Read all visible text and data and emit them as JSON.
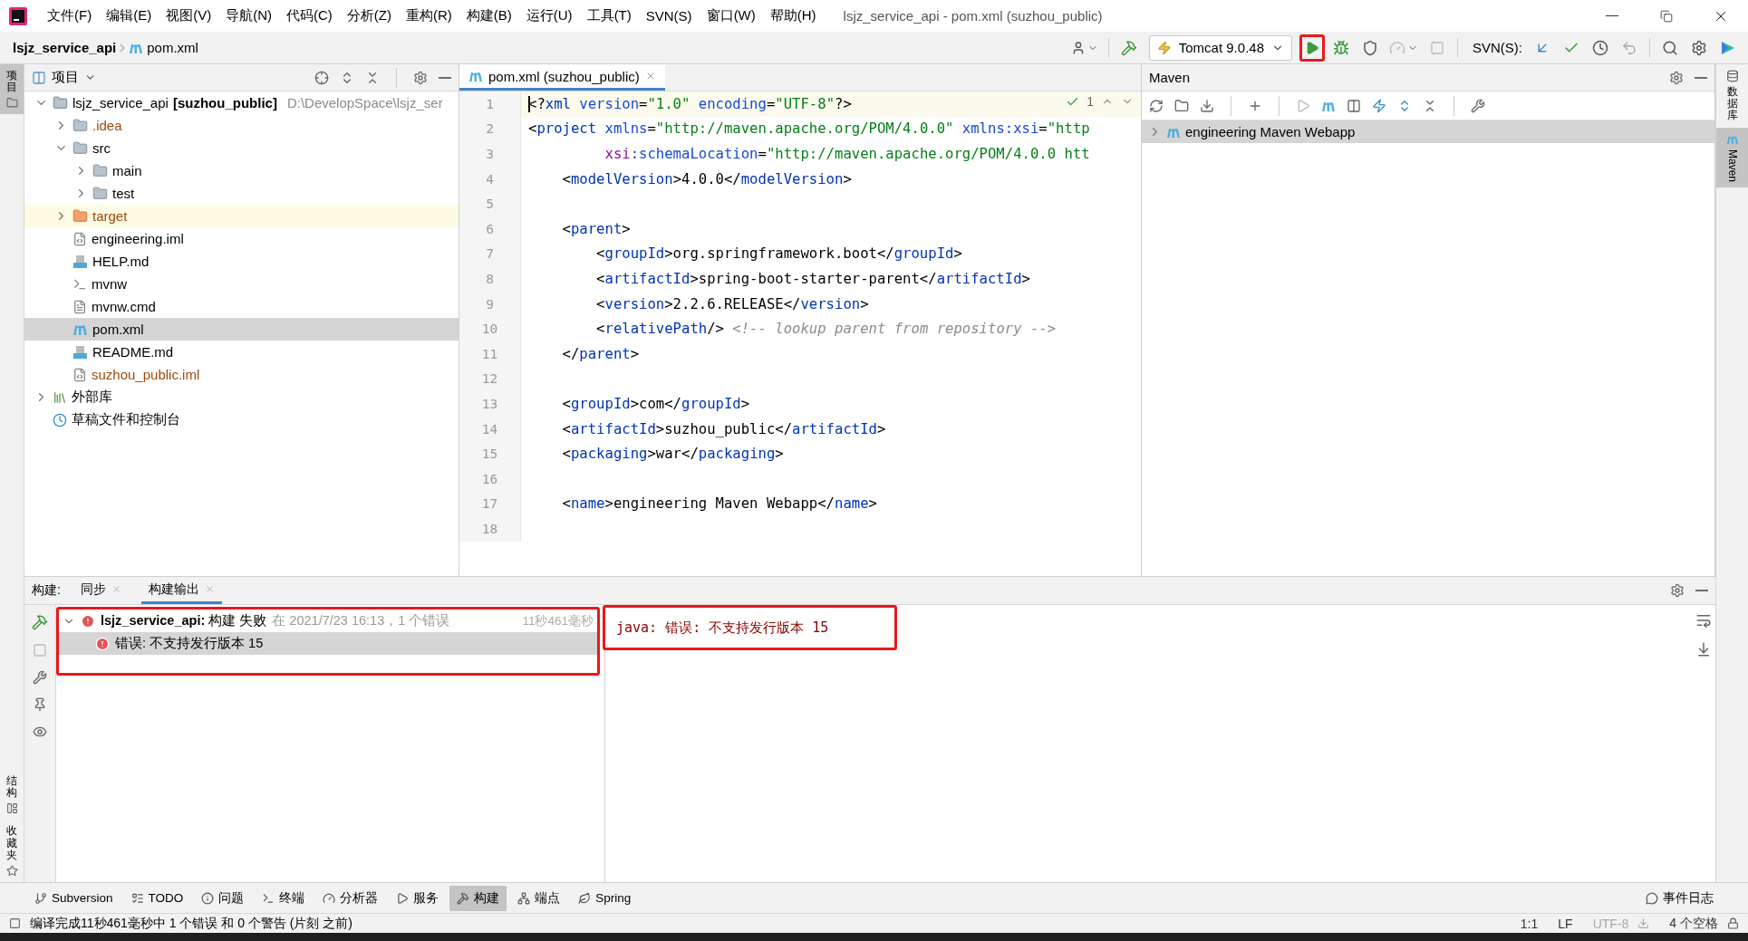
{
  "menu": [
    "文件(F)",
    "编辑(E)",
    "视图(V)",
    "导航(N)",
    "代码(C)",
    "分析(Z)",
    "重构(R)",
    "构建(B)",
    "运行(U)",
    "工具(T)",
    "SVN(S)",
    "窗口(W)",
    "帮助(H)"
  ],
  "window_title": "lsjz_service_api - pom.xml (suzhou_public)",
  "breadcrumb": [
    "lsjz_service_api",
    "pom.xml"
  ],
  "run_config": "Tomcat 9.0.48",
  "svn_label": "SVN(S):",
  "left_strip": {
    "top": [
      {
        "label": "项目",
        "selected": true
      }
    ],
    "bottom": [
      {
        "label": "结构",
        "selected": false
      },
      {
        "label": "收藏夹",
        "selected": false
      }
    ]
  },
  "project_panel": {
    "title": "项目",
    "tree": [
      {
        "kind": "module",
        "label": "lsjz_service_api",
        "module": "[suzhou_public]",
        "path": "D:\\DevelopSpace\\lsjz_ser",
        "color": "#000000",
        "expanded": true,
        "selected": false,
        "highlighted": false,
        "children": [
          {
            "kind": "folder",
            "label": ".idea",
            "color": "#9c4a0e",
            "expanded": false,
            "selected": false,
            "highlighted": false
          },
          {
            "kind": "folder",
            "label": "src",
            "color": "#000000",
            "expanded": true,
            "selected": false,
            "highlighted": false,
            "children": [
              {
                "kind": "folder",
                "label": "main",
                "color": "#000000",
                "expanded": false,
                "selected": false,
                "highlighted": false
              },
              {
                "kind": "folder",
                "label": "test",
                "color": "#000000",
                "expanded": false,
                "selected": false,
                "highlighted": false
              }
            ]
          },
          {
            "kind": "excluded",
            "label": "target",
            "color": "#9c4a0e",
            "expanded": false,
            "selected": false,
            "highlighted": true
          },
          {
            "kind": "iml",
            "label": "engineering.iml",
            "color": "#000000",
            "selected": false,
            "highlighted": false
          },
          {
            "kind": "md",
            "label": "HELP.md",
            "color": "#000000",
            "selected": false,
            "highlighted": false
          },
          {
            "kind": "script",
            "label": "mvnw",
            "color": "#000000",
            "selected": false,
            "highlighted": false
          },
          {
            "kind": "text",
            "label": "mvnw.cmd",
            "color": "#000000",
            "selected": false,
            "highlighted": false
          },
          {
            "kind": "maven",
            "label": "pom.xml",
            "color": "#000000",
            "selected": true,
            "highlighted": false
          },
          {
            "kind": "md",
            "label": "README.md",
            "color": "#000000",
            "selected": false,
            "highlighted": false
          },
          {
            "kind": "iml",
            "label": "suzhou_public.iml",
            "color": "#9c4a0e",
            "selected": false,
            "highlighted": false
          }
        ]
      },
      {
        "kind": "library",
        "label": "外部库",
        "color": "#000000",
        "expanded": false,
        "selected": false,
        "highlighted": false
      },
      {
        "kind": "scratch",
        "label": "草稿文件和控制台",
        "color": "#000000",
        "selected": false,
        "highlighted": false
      }
    ]
  },
  "editor": {
    "tabs": [
      {
        "label": "pom.xml (suzhou_public)",
        "selected": true
      }
    ],
    "check_count": "1",
    "lines": [
      {
        "number": "1",
        "current": true,
        "tokens": [
          {
            "kind": "p",
            "text": "<?"
          },
          {
            "kind": "tag",
            "text": "xml"
          },
          {
            "kind": "attr",
            "text": " version"
          },
          {
            "kind": "p",
            "text": "="
          },
          {
            "kind": "val",
            "text": "\"1.0\""
          },
          {
            "kind": "attr",
            "text": " encoding"
          },
          {
            "kind": "p",
            "text": "="
          },
          {
            "kind": "val",
            "text": "\"UTF-8\""
          },
          {
            "kind": "p",
            "text": "?>"
          }
        ]
      },
      {
        "number": "2",
        "current": false,
        "tokens": [
          {
            "kind": "p",
            "text": "<"
          },
          {
            "kind": "tag",
            "text": "project"
          },
          {
            "kind": "attr",
            "text": " xmlns"
          },
          {
            "kind": "p",
            "text": "="
          },
          {
            "kind": "val",
            "text": "\"http://maven.apache.org/POM/4.0.0\""
          },
          {
            "kind": "attr",
            "text": " xmlns:xsi"
          },
          {
            "kind": "p",
            "text": "="
          },
          {
            "kind": "val",
            "text": "\"http"
          }
        ]
      },
      {
        "number": "3",
        "current": false,
        "tokens": [
          {
            "kind": "ns",
            "text": "         xsi"
          },
          {
            "kind": "attr",
            "text": ":schemaLocation"
          },
          {
            "kind": "p",
            "text": "="
          },
          {
            "kind": "val",
            "text": "\"http://maven.apache.org/POM/4.0.0 htt"
          }
        ]
      },
      {
        "number": "4",
        "current": false,
        "tokens": [
          {
            "kind": "p",
            "text": "    <"
          },
          {
            "kind": "tag",
            "text": "modelVersion"
          },
          {
            "kind": "p",
            "text": ">4.0.0</"
          },
          {
            "kind": "tag",
            "text": "modelVersion"
          },
          {
            "kind": "p",
            "text": ">"
          }
        ]
      },
      {
        "number": "5",
        "current": false
      },
      {
        "number": "6",
        "current": false,
        "tokens": [
          {
            "kind": "p",
            "text": "    <"
          },
          {
            "kind": "tag",
            "text": "parent"
          },
          {
            "kind": "p",
            "text": ">"
          }
        ]
      },
      {
        "number": "7",
        "current": false,
        "tokens": [
          {
            "kind": "p",
            "text": "        <"
          },
          {
            "kind": "tag",
            "text": "groupId"
          },
          {
            "kind": "p",
            "text": ">org.springframework.boot</"
          },
          {
            "kind": "tag",
            "text": "groupId"
          },
          {
            "kind": "p",
            "text": ">"
          }
        ]
      },
      {
        "number": "8",
        "current": false,
        "tokens": [
          {
            "kind": "p",
            "text": "        <"
          },
          {
            "kind": "tag",
            "text": "artifactId"
          },
          {
            "kind": "p",
            "text": ">spring-boot-starter-parent</"
          },
          {
            "kind": "tag",
            "text": "artifactId"
          },
          {
            "kind": "p",
            "text": ">"
          }
        ]
      },
      {
        "number": "9",
        "current": false,
        "tokens": [
          {
            "kind": "p",
            "text": "        <"
          },
          {
            "kind": "tag",
            "text": "version"
          },
          {
            "kind": "p",
            "text": ">2.2.6.RELEASE</"
          },
          {
            "kind": "tag",
            "text": "version"
          },
          {
            "kind": "p",
            "text": ">"
          }
        ]
      },
      {
        "number": "10",
        "current": false,
        "tokens": [
          {
            "kind": "p",
            "text": "        <"
          },
          {
            "kind": "tag",
            "text": "relativePath"
          },
          {
            "kind": "p",
            "text": "/> "
          },
          {
            "kind": "cm",
            "text": "<!-- lookup parent from repository -->"
          }
        ]
      },
      {
        "number": "11",
        "current": false,
        "tokens": [
          {
            "kind": "p",
            "text": "    </"
          },
          {
            "kind": "tag",
            "text": "parent"
          },
          {
            "kind": "p",
            "text": ">"
          }
        ]
      },
      {
        "number": "12",
        "current": false
      },
      {
        "number": "13",
        "current": false,
        "tokens": [
          {
            "kind": "p",
            "text": "    <"
          },
          {
            "kind": "tag",
            "text": "groupId"
          },
          {
            "kind": "p",
            "text": ">com</"
          },
          {
            "kind": "tag",
            "text": "groupId"
          },
          {
            "kind": "p",
            "text": ">"
          }
        ]
      },
      {
        "number": "14",
        "current": false,
        "tokens": [
          {
            "kind": "p",
            "text": "    <"
          },
          {
            "kind": "tag",
            "text": "artifactId"
          },
          {
            "kind": "p",
            "text": ">suzhou_public</"
          },
          {
            "kind": "tag",
            "text": "artifactId"
          },
          {
            "kind": "p",
            "text": ">"
          }
        ]
      },
      {
        "number": "15",
        "current": false,
        "tokens": [
          {
            "kind": "p",
            "text": "    <"
          },
          {
            "kind": "tag",
            "text": "packaging"
          },
          {
            "kind": "p",
            "text": ">war</"
          },
          {
            "kind": "tag",
            "text": "packaging"
          },
          {
            "kind": "p",
            "text": ">"
          }
        ]
      },
      {
        "number": "16",
        "current": false
      },
      {
        "number": "17",
        "current": false,
        "tokens": [
          {
            "kind": "p",
            "text": "    <"
          },
          {
            "kind": "tag",
            "text": "name"
          },
          {
            "kind": "p",
            "text": ">engineering Maven Webapp</"
          },
          {
            "kind": "tag",
            "text": "name"
          },
          {
            "kind": "p",
            "text": ">"
          }
        ]
      },
      {
        "number": "18",
        "current": false
      }
    ]
  },
  "maven_panel": {
    "title": "Maven",
    "tree": [
      {
        "label": "engineering Maven Webapp",
        "expanded": false,
        "selected": true
      }
    ]
  },
  "right_strip": [
    {
      "label": "数据库",
      "kind": "cjk",
      "selected": false
    },
    {
      "label": "Maven",
      "kind": "latin",
      "selected": true
    }
  ],
  "build_panel": {
    "label": "构建:",
    "tabs": [
      {
        "label": "同步",
        "selected": false
      },
      {
        "label": "构建输出",
        "selected": true
      }
    ],
    "tree": [
      {
        "text": "**lsjz_service_api:** 构建 失败",
        "detail": "在 2021/7/23 16:13，1 个错误",
        "duration": "11秒461毫秒",
        "expanded": true,
        "selected": false,
        "children": [
          {
            "text": "错误: 不支持发行版本 15",
            "selected": true
          }
        ]
      }
    ],
    "output": "java: 错误: 不支持发行版本 15"
  },
  "tool_windows": [
    {
      "label": "Subversion",
      "kind": "vcs",
      "selected": false
    },
    {
      "label": "TODO",
      "kind": "todo",
      "selected": false
    },
    {
      "label": "问题",
      "kind": "problems",
      "selected": false
    },
    {
      "label": "终端",
      "kind": "terminal",
      "selected": false
    },
    {
      "label": "分析器",
      "kind": "profiler",
      "selected": false
    },
    {
      "label": "服务",
      "kind": "services",
      "selected": false
    },
    {
      "label": "构建",
      "kind": "build",
      "selected": true
    },
    {
      "label": "端点",
      "kind": "endpoints",
      "selected": false
    },
    {
      "label": "Spring",
      "kind": "spring",
      "selected": false
    }
  ],
  "event_log": "事件日志",
  "status_bar": {
    "message": "编译完成11秒461毫秒中 1 个错误 和 0 个警告 (片刻 之前)",
    "position": "1:1",
    "line_ending": "LF",
    "encoding": "UTF-8",
    "indent": "4 个空格"
  }
}
